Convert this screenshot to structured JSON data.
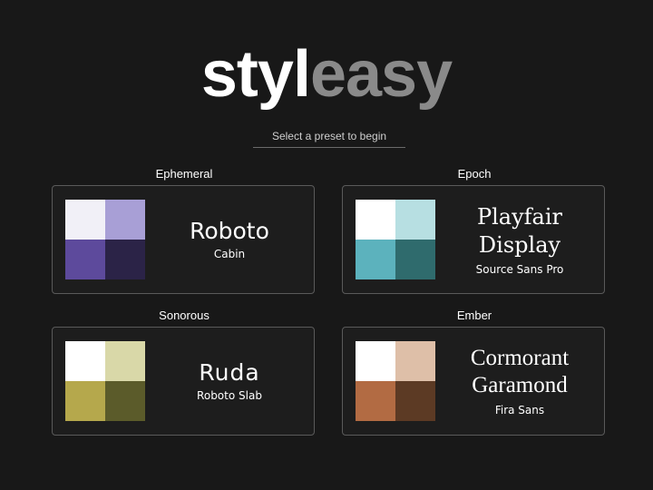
{
  "brand": {
    "logo_part1": "styl",
    "logo_part2": "easy"
  },
  "subtitle": "Select a preset to begin",
  "presets": [
    {
      "name": "Ephemeral",
      "heading_font_line1": "Roboto",
      "heading_font_line2": "",
      "body_font": "Cabin",
      "colors": [
        "#f1f0f7",
        "#a89fd6",
        "#5d4a9c",
        "#2b2347"
      ]
    },
    {
      "name": "Epoch",
      "heading_font_line1": "Playfair",
      "heading_font_line2": "Display",
      "body_font": "Source Sans Pro",
      "colors": [
        "#ffffff",
        "#b7dfe2",
        "#5cb2bd",
        "#2f6b6d"
      ]
    },
    {
      "name": "Sonorous",
      "heading_font_line1": "Ruda",
      "heading_font_line2": "",
      "body_font": "Roboto Slab",
      "colors": [
        "#ffffff",
        "#d9d8a8",
        "#b5a84c",
        "#5b5b2a"
      ]
    },
    {
      "name": "Ember",
      "heading_font_line1": "Cormorant",
      "heading_font_line2": "Garamond",
      "body_font": "Fira Sans",
      "colors": [
        "#ffffff",
        "#debfa8",
        "#b26b43",
        "#5c3a24"
      ]
    }
  ]
}
